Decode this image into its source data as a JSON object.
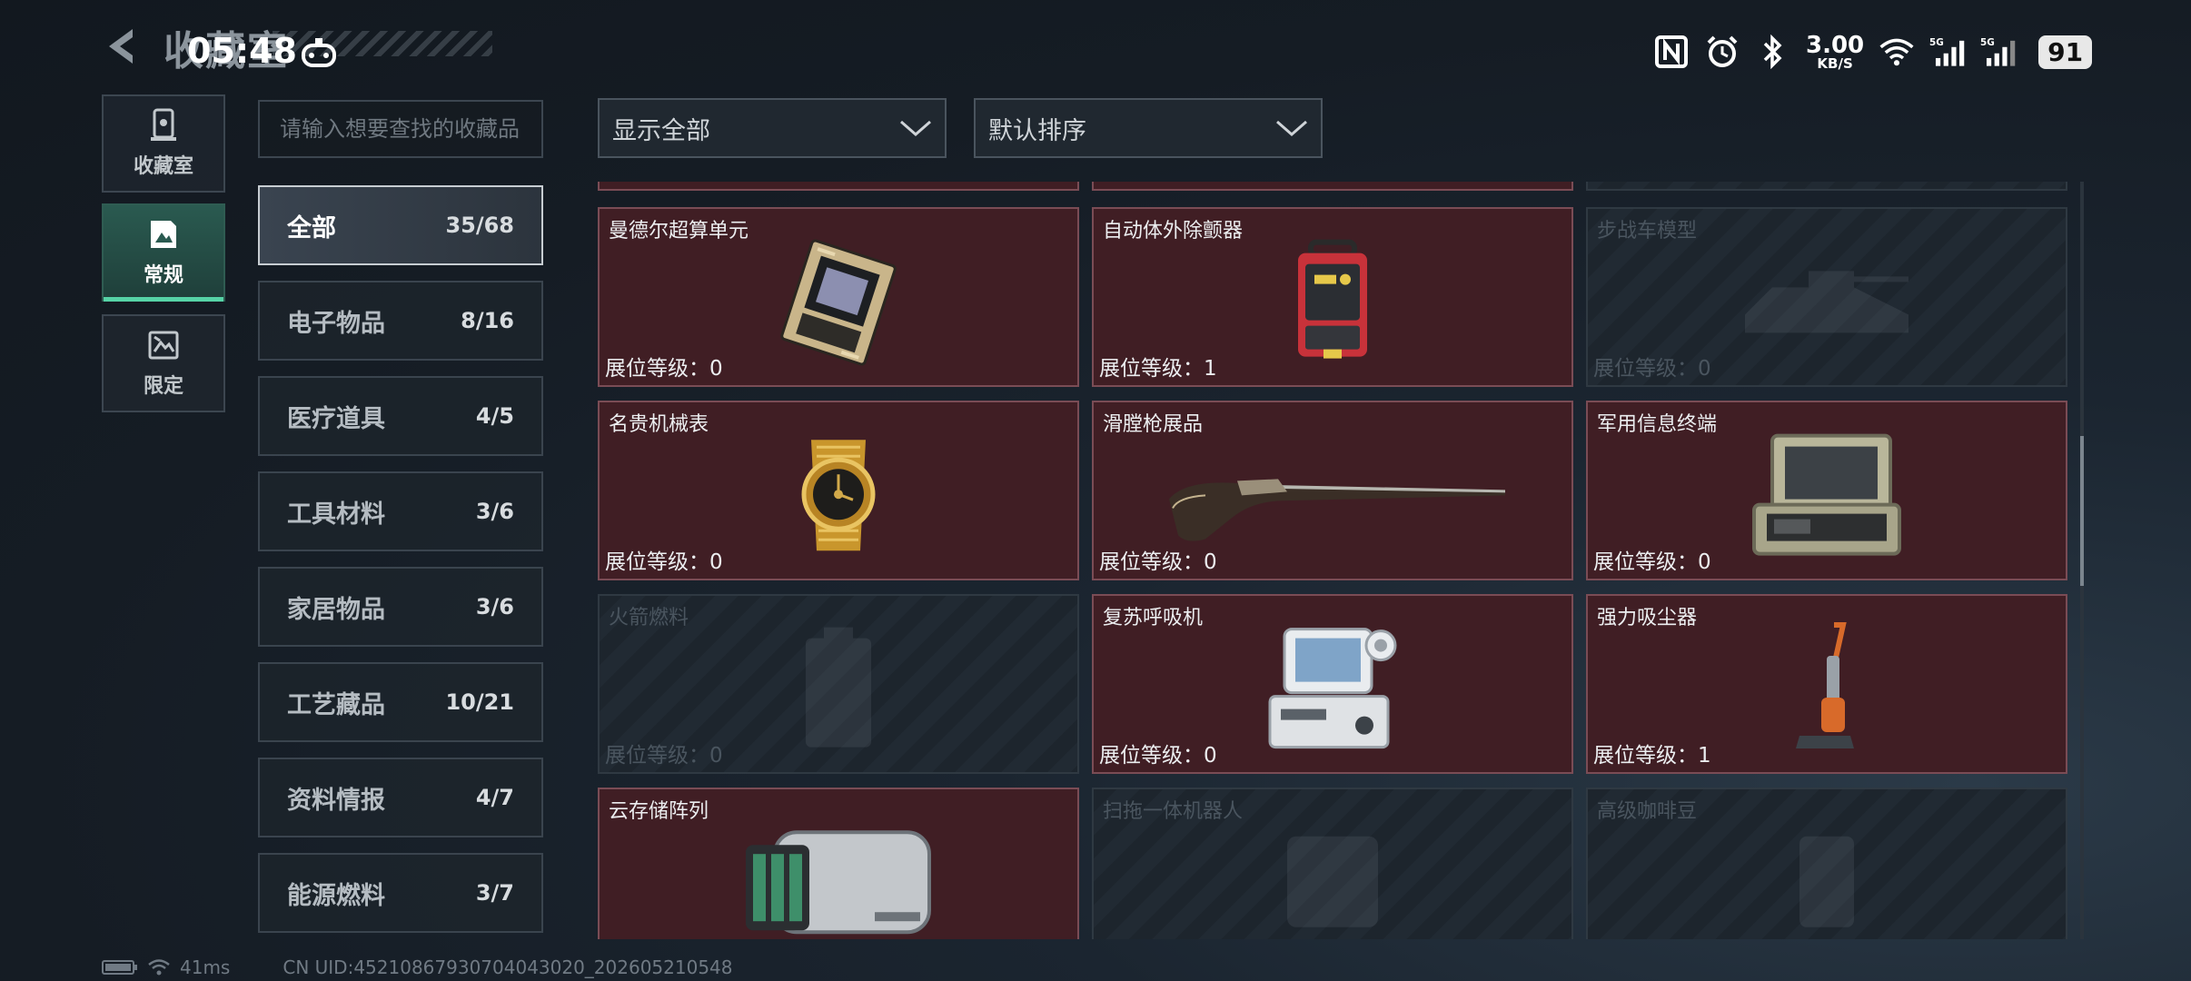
{
  "header": {
    "title": "收藏室",
    "clock": "05:48"
  },
  "status_bar": {
    "net_speed_value": "3.00",
    "net_speed_unit": "KB/S",
    "battery": "91",
    "icons": [
      "nfc-icon",
      "alarm-icon",
      "bluetooth-icon",
      "wifi-icon",
      "signal-5g-icon",
      "signal-5g-icon"
    ]
  },
  "mode_nav": [
    {
      "label": "收藏室",
      "icon": "collection-room-icon",
      "active": false
    },
    {
      "label": "常规",
      "icon": "regular-icon",
      "active": true
    },
    {
      "label": "限定",
      "icon": "limited-icon",
      "active": false
    }
  ],
  "search": {
    "placeholder": "请输入想要查找的收藏品"
  },
  "categories": [
    {
      "name": "全部",
      "count": "35/68",
      "active": true
    },
    {
      "name": "电子物品",
      "count": "8/16"
    },
    {
      "name": "医疗道具",
      "count": "4/5"
    },
    {
      "name": "工具材料",
      "count": "3/6"
    },
    {
      "name": "家居物品",
      "count": "3/6"
    },
    {
      "name": "工艺藏品",
      "count": "10/21"
    },
    {
      "name": "资料情报",
      "count": "4/7"
    },
    {
      "name": "能源燃料",
      "count": "3/7"
    }
  ],
  "filters": {
    "display": "显示全部",
    "sort": "默认排序"
  },
  "items": [
    {
      "name": "曼德尔超算单元",
      "level_label": "展位等级：",
      "level": "0",
      "locked": false,
      "icon": "supercomputer-unit-icon"
    },
    {
      "name": "自动体外除颤器",
      "level_label": "展位等级：",
      "level": "1",
      "locked": false,
      "icon": "defibrillator-icon"
    },
    {
      "name": "步战车模型",
      "level_label": "展位等级：",
      "level": "0",
      "locked": true,
      "icon": "ifv-model-icon"
    },
    {
      "name": "名贵机械表",
      "level_label": "展位等级：",
      "level": "0",
      "locked": false,
      "icon": "luxury-watch-icon"
    },
    {
      "name": "滑膛枪展品",
      "level_label": "展位等级：",
      "level": "0",
      "locked": false,
      "icon": "musket-icon"
    },
    {
      "name": "军用信息终端",
      "level_label": "展位等级：",
      "level": "0",
      "locked": false,
      "icon": "military-terminal-icon"
    },
    {
      "name": "火箭燃料",
      "level_label": "展位等级：",
      "level": "0",
      "locked": true,
      "icon": "rocket-fuel-icon"
    },
    {
      "name": "复苏呼吸机",
      "level_label": "展位等级：",
      "level": "0",
      "locked": false,
      "icon": "ventilator-icon"
    },
    {
      "name": "强力吸尘器",
      "level_label": "展位等级：",
      "level": "1",
      "locked": false,
      "icon": "vacuum-cleaner-icon"
    },
    {
      "name": "云存储阵列",
      "level_label": "",
      "level": "",
      "locked": false,
      "icon": "storage-array-icon"
    },
    {
      "name": "扫拖一体机器人",
      "level_label": "",
      "level": "",
      "locked": true,
      "icon": "mop-robot-icon"
    },
    {
      "name": "高级咖啡豆",
      "level_label": "",
      "level": "",
      "locked": true,
      "icon": "coffee-beans-icon"
    }
  ],
  "footer": {
    "ping": "41ms",
    "uid": "CN UID:45210867930704043020_202605210548"
  }
}
